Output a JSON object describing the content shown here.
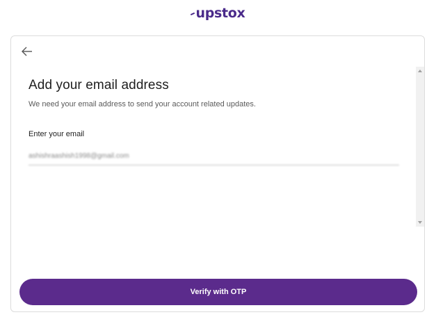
{
  "brand": {
    "logo_text": "upstox",
    "color": "#4a2a8a"
  },
  "navigation": {
    "back_icon": "arrow-left-icon"
  },
  "form": {
    "title": "Add your email address",
    "subtitle": "We need your email address to send your account related updates.",
    "email_label": "Enter your email",
    "email_value": "ashishraashish1998@gmail.com"
  },
  "actions": {
    "verify_label": "Verify with OTP",
    "verify_color": "#5b2b8c"
  }
}
